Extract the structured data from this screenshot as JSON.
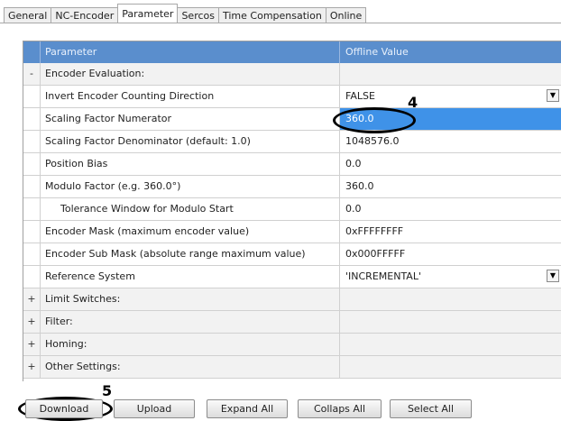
{
  "tabs": [
    {
      "label": "General",
      "active": false
    },
    {
      "label": "NC-Encoder",
      "active": false
    },
    {
      "label": "Parameter",
      "active": true
    },
    {
      "label": "Sercos",
      "active": false
    },
    {
      "label": "Time Compensation",
      "active": false
    },
    {
      "label": "Online",
      "active": false
    }
  ],
  "grid": {
    "header": {
      "parameter": "Parameter",
      "value": "Offline Value"
    },
    "rows": [
      {
        "toggle": "-",
        "name": "Encoder Evaluation:",
        "value": "",
        "group": true
      },
      {
        "toggle": "",
        "name": "Invert Encoder Counting Direction",
        "value": "FALSE",
        "dropdown": true
      },
      {
        "toggle": "",
        "name": "Scaling Factor Numerator",
        "value": "360.0",
        "selected": true
      },
      {
        "toggle": "",
        "name": "Scaling Factor Denominator (default: 1.0)",
        "value": "1048576.0"
      },
      {
        "toggle": "",
        "name": "Position Bias",
        "value": "0.0"
      },
      {
        "toggle": "",
        "name": "Modulo Factor (e.g. 360.0°)",
        "value": "360.0"
      },
      {
        "toggle": "",
        "name": "Tolerance Window for Modulo Start",
        "value": "0.0",
        "indent": true
      },
      {
        "toggle": "",
        "name": "Encoder Mask (maximum encoder value)",
        "value": "0xFFFFFFFF"
      },
      {
        "toggle": "",
        "name": "Encoder Sub Mask (absolute range maximum value)",
        "value": "0x000FFFFF"
      },
      {
        "toggle": "",
        "name": "Reference System",
        "value": "'INCREMENTAL'",
        "dropdown": true
      },
      {
        "toggle": "+",
        "name": "Limit Switches:",
        "value": "",
        "group": true
      },
      {
        "toggle": "+",
        "name": "Filter:",
        "value": "",
        "group": true
      },
      {
        "toggle": "+",
        "name": "Homing:",
        "value": "",
        "group": true
      },
      {
        "toggle": "+",
        "name": "Other Settings:",
        "value": "",
        "group": true
      }
    ]
  },
  "dropdown_glyph": "▼",
  "annotations": {
    "marker_4": "4",
    "marker_5": "5"
  },
  "buttons": {
    "download": "Download",
    "upload": "Upload",
    "expand_all": "Expand All",
    "collaps_all": "Collaps All",
    "select_all": "Select All"
  },
  "colors": {
    "header": "#5a8ecd",
    "selected": "#3f92e8"
  }
}
